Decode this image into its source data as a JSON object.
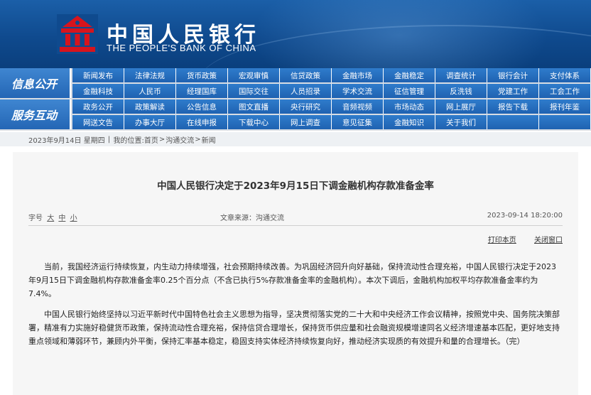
{
  "header": {
    "brand_cn": "中国人民银行",
    "brand_en": "THE PEOPLE'S BANK OF CHINA",
    "colors": {
      "header_blue": "#0f4a8e",
      "logo_red": "#d7141d",
      "nav_blue": "#1f62b1"
    }
  },
  "nav": {
    "section1_label": "信息公开",
    "section2_label": "服务互动",
    "row1": [
      "新闻发布",
      "法律法规",
      "货币政策",
      "宏观审慎",
      "信贷政策",
      "金融市场",
      "金融稳定",
      "调查统计",
      "银行会计",
      "支付体系"
    ],
    "row2": [
      "金融科技",
      "人民币",
      "经理国库",
      "国际交往",
      "人员招录",
      "学术交流",
      "征信管理",
      "反洗钱",
      "党建工作",
      "工会工作"
    ],
    "row3": [
      "政务公开",
      "政策解读",
      "公告信息",
      "图文直播",
      "央行研究",
      "音频视频",
      "市场动态",
      "网上展厅",
      "报告下载",
      "报刊年鉴"
    ],
    "row4": [
      "网送文告",
      "办事大厅",
      "在线申报",
      "下载中心",
      "网上调查",
      "意见征集",
      "金融知识",
      "关于我们"
    ]
  },
  "breadcrumb": {
    "date": "2023年9月14日",
    "weekday": "星期四",
    "sep": "|",
    "location_label": "我的位置:",
    "home": "首页",
    "arrow": ">",
    "channel": "沟通交流",
    "current": "新闻"
  },
  "article": {
    "title": "中国人民银行决定于2023年9月15日下调金融机构存款准备金率",
    "font_size_label": "字号",
    "size_large": "大",
    "size_medium": "中",
    "size_small": "小",
    "source": "文章来源：沟通交流",
    "date": "2023-09-14 18:20:00",
    "print": "打印本页",
    "close": "关闭窗口",
    "paragraphs": [
      "当前，我国经济运行持续恢复，内生动力持续增强，社会预期持续改善。为巩固经济回升向好基础，保持流动性合理充裕，中国人民银行决定于2023年9月15日下调金融机构存款准备金率0.25个百分点（不含已执行5%存款准备金率的金融机构）。本次下调后，金融机构加权平均存款准备金率约为7.4%。",
      "中国人民银行始终坚持以习近平新时代中国特色社会主义思想为指导，坚决贯彻落实党的二十大和中央经济工作会议精神，按照党中央、国务院决策部署，精准有力实施好稳健货币政策，保持流动性合理充裕，保持信贷合理增长，保持货币供应量和社会融资规模增速同名义经济增速基本匹配，更好地支持重点领域和薄弱环节，兼顾内外平衡，保持汇率基本稳定，稳固支持实体经济持续恢复向好，推动经济实现质的有效提升和量的合理增长。（完）"
    ]
  }
}
